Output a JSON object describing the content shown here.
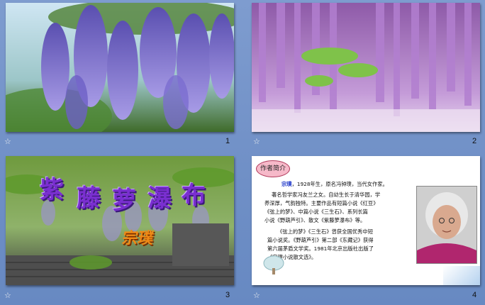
{
  "slides": [
    {
      "number": "1",
      "icon": "sound-icon"
    },
    {
      "number": "2",
      "icon": "sound-icon"
    },
    {
      "number": "3",
      "icon": "sound-icon",
      "title_chars": [
        "紫",
        "藤",
        "萝",
        "瀑",
        "布"
      ],
      "author": "宗璞"
    },
    {
      "number": "4",
      "icon": "sound-icon",
      "badge": "作者简介",
      "bio_name": "宗璞",
      "bio_lines": [
        "，1928年生，原名冯钟璞，当代女作家。",
        "著名哲学家冯友兰之女。自幼生长于清华园，学",
        "养深厚，气韵独特。主要作品有短篇小说《红豆》",
        "《弦上的梦》、中篇小说《三生石》、系列长篇",
        "小说《野葫芦引》、散文《紫藤萝瀑布》等。",
        "《弦上的梦》《三生石》曾获全国优秀中短",
        "篇小说奖。《野葫芦引》第二部《东藏记》获得",
        "第六届茅盾文学奖。1981年北京出版社出版了",
        "《宗璞小说散文选》。"
      ]
    }
  ],
  "colors": {
    "background": "#7395cb",
    "title_purple": "#7a2fd0",
    "author_orange": "#f08a16",
    "badge_pink": "#f6b9c9",
    "name_blue": "#1a33c8"
  }
}
